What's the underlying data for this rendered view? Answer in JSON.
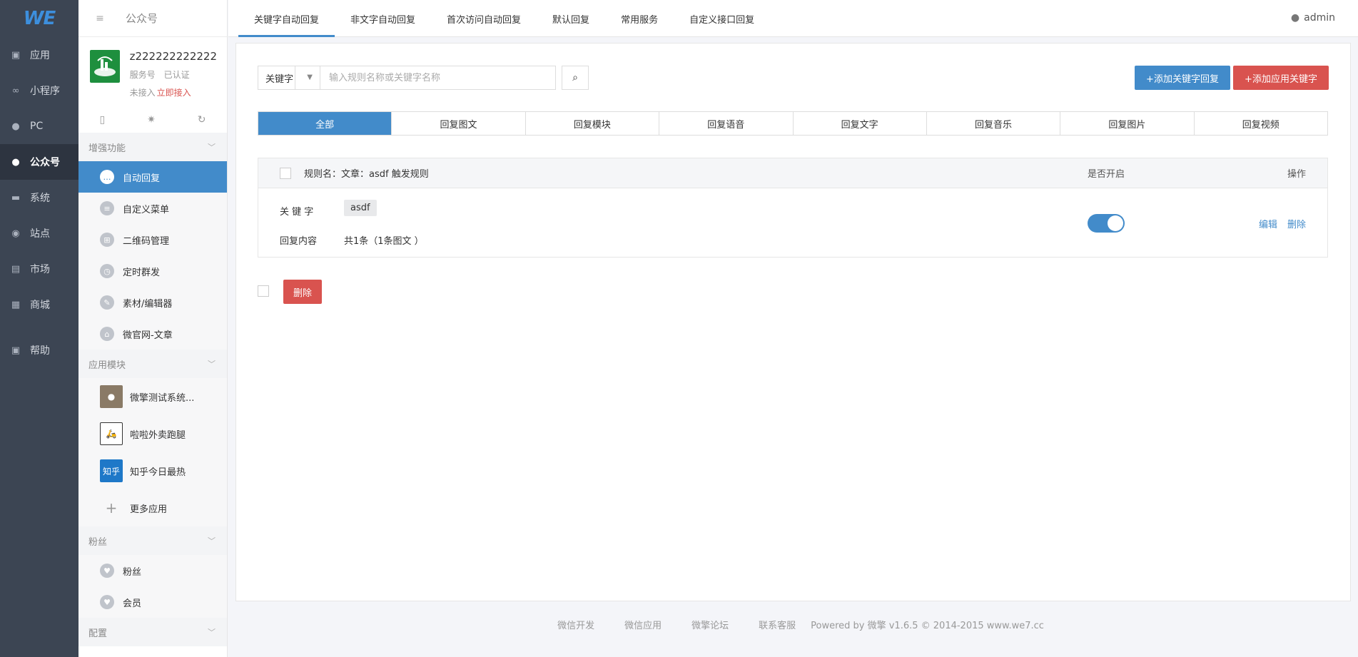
{
  "rail": {
    "logo": "WE",
    "items": [
      {
        "label": "应用",
        "icon": "cube-icon"
      },
      {
        "label": "小程序",
        "icon": "link-icon"
      },
      {
        "label": "PC",
        "icon": "user-icon"
      },
      {
        "label": "公众号",
        "icon": "user-icon"
      },
      {
        "label": "系统",
        "icon": "monitor-icon"
      },
      {
        "label": "站点",
        "icon": "globe-icon"
      },
      {
        "label": "市场",
        "icon": "cart-icon"
      },
      {
        "label": "商城",
        "icon": "store-icon"
      },
      {
        "label": "帮助",
        "icon": "help-icon"
      }
    ]
  },
  "sidebar": {
    "title": "公众号",
    "account": {
      "name": "z222222222222",
      "type": "服务号",
      "verified": "已认证",
      "status": "未接入",
      "connect_link": "立即接入"
    },
    "groups": {
      "enhance": "增强功能",
      "modules": "应用模块",
      "fans": "粉丝",
      "config": "配置"
    },
    "enhance_items": [
      "自动回复",
      "自定义菜单",
      "二维码管理",
      "定时群发",
      "素材/编辑器",
      "微官网-文章"
    ],
    "module_items": [
      "微擎测试系统...",
      "啦啦外卖跑腿",
      "知乎今日最热",
      "更多应用"
    ],
    "module_icon_text": "知乎",
    "fans_items": [
      "粉丝",
      "会员"
    ]
  },
  "topbar": {
    "tabs": [
      "关键字自动回复",
      "非文字自动回复",
      "首次访问自动回复",
      "默认回复",
      "常用服务",
      "自定义接口回复"
    ],
    "user": "admin"
  },
  "main": {
    "search": {
      "select_value": "关键字",
      "placeholder": "输入规则名称或关键字名称"
    },
    "add_keyword_button": "+添加关键字回复",
    "add_app_keyword_button": "+添加应用关键字",
    "filter_tabs": [
      "全部",
      "回复图文",
      "回复模块",
      "回复语音",
      "回复文字",
      "回复音乐",
      "回复图片",
      "回复视频"
    ],
    "rule": {
      "name": "规则名：文章：asdf 触发规则",
      "col_enabled": "是否开启",
      "col_actions": "操作",
      "keyword_label": "关 键 字",
      "keyword": "asdf",
      "reply_label": "回复内容",
      "reply_value": "共1条（1条图文 ）",
      "enabled": true,
      "edit": "编辑",
      "delete": "删除"
    },
    "delete_button": "删除"
  },
  "footer": {
    "links": [
      "微信开发",
      "微信应用",
      "微擎论坛",
      "联系客服"
    ],
    "powered": "Powered by 微擎 v1.6.5 © 2014-2015 www.we7.cc"
  },
  "colors": {
    "primary": "#428bca",
    "danger": "#d9534f",
    "rail": "#3c4553"
  }
}
